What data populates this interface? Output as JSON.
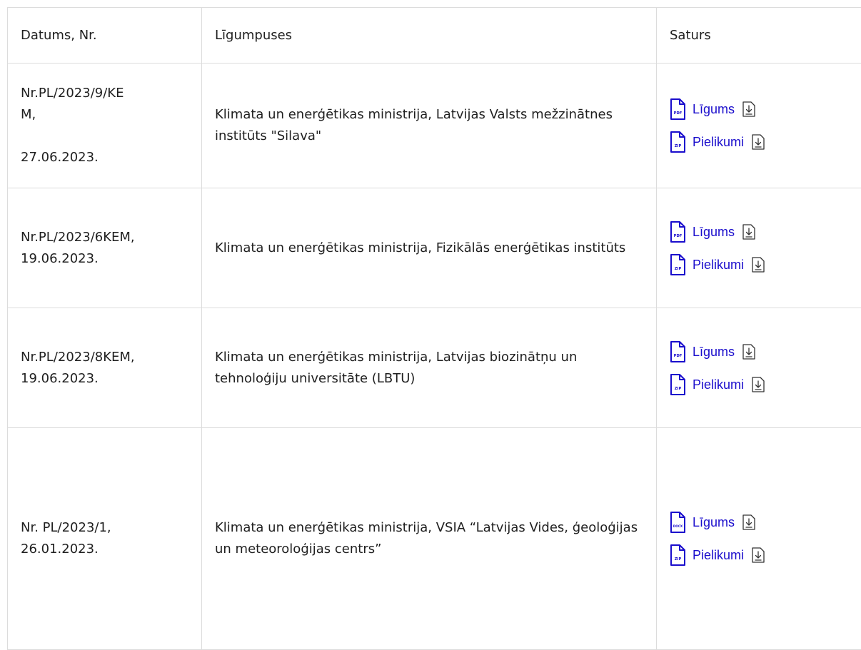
{
  "table": {
    "headers": {
      "date": "Datums, Nr.",
      "parties": "Līgumpuses",
      "content": "Saturs"
    },
    "rows": [
      {
        "date_lines": "Nr.PL/2023/9/KE\nM,\n\n27.06.2023.",
        "parties": "Klimata un enerģētikas ministrija, Latvijas Valsts mežzinātnes institūts \"Silava\"",
        "files": [
          {
            "label": "Līgums",
            "type": "PDF"
          },
          {
            "label": "Pielikumi",
            "type": "ZIP"
          }
        ]
      },
      {
        "date_lines": "Nr.PL/2023/6KEM,\n19.06.2023.",
        "parties": "Klimata un enerģētikas ministrija, Fizikālās enerģētikas institūts",
        "files": [
          {
            "label": "Līgums",
            "type": "PDF"
          },
          {
            "label": "Pielikumi",
            "type": "ZIP"
          }
        ]
      },
      {
        "date_lines": "Nr.PL/2023/8KEM,\n19.06.2023.",
        "parties": "Klimata un enerģētikas ministrija, Latvijas biozinātņu un tehnoloģiju universitāte (LBTU)",
        "files": [
          {
            "label": "Līgums",
            "type": "PDF"
          },
          {
            "label": "Pielikumi",
            "type": "ZIP"
          }
        ]
      },
      {
        "date_lines": "Nr. PL/2023/1,\n26.01.2023.",
        "parties": "Klimata un enerģētikas ministrija, VSIA “Latvijas Vides, ģeoloģijas un meteoroloģijas centrs”",
        "files": [
          {
            "label": "Līgums",
            "type": "DOCX"
          },
          {
            "label": "Pielikumi",
            "type": "ZIP"
          }
        ]
      }
    ]
  },
  "colors": {
    "link": "#1a0dcc",
    "border": "#dcdcdc",
    "text": "#1f1f1f"
  },
  "icons": {
    "file": "file-type-icon",
    "download": "download-icon"
  }
}
